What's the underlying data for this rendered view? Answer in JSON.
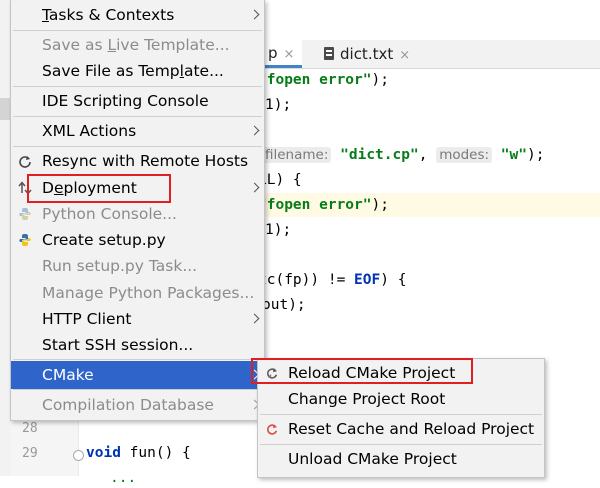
{
  "editor": {
    "tabs": [
      {
        "label": "p",
        "close": "×"
      },
      {
        "label": "dict.txt",
        "close": "×"
      }
    ],
    "code": {
      "l1": {
        "str": "\"fopen error\"",
        "tail": ");"
      },
      "l2": "1);",
      "l3": {
        "hint1": "filename:",
        "str1": "\"dict.cp\"",
        "sep": ",",
        "hint2": "modes:",
        "str2": "\"w\"",
        "tail": ");"
      },
      "l4": "LL) {",
      "l5": {
        "str": "\"fopen error\"",
        "tail": ");"
      },
      "l6": "1);",
      "l7": {
        "head": "tc(fp)) != ",
        "kw": "EOF",
        "tail": ") {"
      },
      "l8": "out);",
      "line_numbers": [
        "28",
        "29"
      ],
      "l29": {
        "kw": "void",
        "rest": " fun() {"
      },
      "partial_bottom": "..."
    }
  },
  "context_menu": {
    "items": {
      "tasks": {
        "pre": "",
        "u": "T",
        "post": "asks & Contexts"
      },
      "save_live": {
        "pre": "Save as ",
        "u": "L",
        "post": "ive Template..."
      },
      "save_file": {
        "pre": "Save File as Temp",
        "u": "l",
        "post": "ate..."
      },
      "ide_scripting": "IDE Scripting Console",
      "xml_actions": "XML Actions",
      "resync": "Resync with Remote Hosts",
      "deployment": {
        "pre": "D",
        "u": "e",
        "post": "ployment"
      },
      "python_console": "Python Console...",
      "create_setup": "Create setup.py",
      "run_setup": "Run setup.py Task...",
      "manage_packages": "Manage Python Packages...",
      "http_client": "HTTP Client",
      "ssh": "Start SSH session...",
      "cmake": "CMake",
      "compilation_db": "Compilation Database"
    }
  },
  "cmake_submenu": {
    "reload": "Reload CMake Project",
    "change_root": "Change Project Root",
    "reset_cache": "Reset Cache and Reload Project",
    "unload": "Unload CMake Project"
  },
  "colors": {
    "menu_bg": "#f2f2f2",
    "selection": "#2f65ca",
    "annotation_red": "#e02020",
    "string_green": "#067d17",
    "keyword_blue": "#0033b3"
  },
  "icons": [
    "sync-icon",
    "deployment-icon",
    "python-icon",
    "reload-icon",
    "reset-icon"
  ]
}
